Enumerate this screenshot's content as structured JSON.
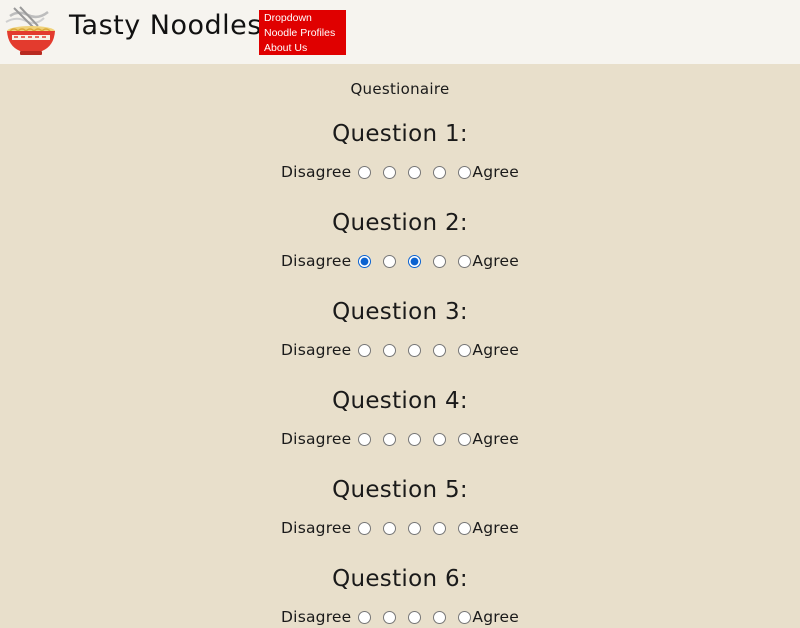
{
  "header": {
    "site_title": "Tasty Noodles",
    "logo_icon": "noodle-bowl-icon",
    "nav": [
      "Dropdown",
      "Noodle Profiles",
      "About Us"
    ],
    "nav_bg": "#e00000"
  },
  "page_title": "Questionaire",
  "scale": {
    "left_label": "Disagree",
    "right_label": "Agree"
  },
  "questions": [
    {
      "title": "Question 1:",
      "selected": []
    },
    {
      "title": "Question 2:",
      "selected": [
        1,
        3
      ]
    },
    {
      "title": "Question 3:",
      "selected": []
    },
    {
      "title": "Question 4:",
      "selected": []
    },
    {
      "title": "Question 5:",
      "selected": []
    },
    {
      "title": "Question 6:",
      "selected": []
    }
  ]
}
